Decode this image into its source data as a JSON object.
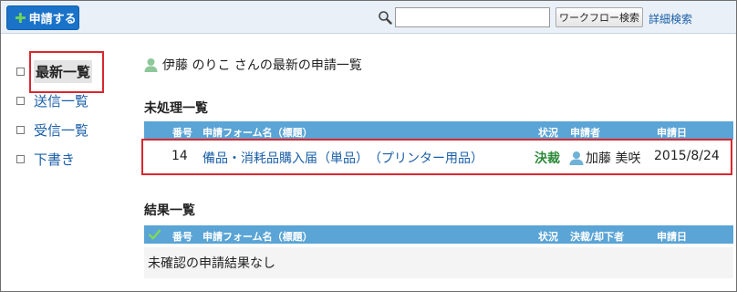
{
  "toolbar": {
    "apply_label": "申請する",
    "search_placeholder": "",
    "workflow_search_label": "ワークフロー検索",
    "advanced_search_label": "詳細検索"
  },
  "sidebar": {
    "items": [
      {
        "label": "最新一覧",
        "active": true
      },
      {
        "label": "送信一覧"
      },
      {
        "label": "受信一覧"
      },
      {
        "label": "下書き"
      }
    ]
  },
  "main": {
    "user_heading": "伊藤 のりこ さんの最新の申請一覧",
    "pending": {
      "title": "未処理一覧",
      "columns": {
        "number": "番号",
        "form_name": "申請フォーム名（標題）",
        "status": "状況",
        "applicant": "申請者",
        "date": "申請日"
      },
      "rows": [
        {
          "number": "14",
          "form_name": "備品・消耗品購入届（単品）　（プリンター用品）",
          "status": "決裁",
          "applicant": "加藤 美咲",
          "date": "2015/8/24"
        }
      ]
    },
    "results": {
      "title": "結果一覧",
      "columns": {
        "number": "番号",
        "form_name": "申請フォーム名（標題）",
        "status": "状況",
        "approver": "決裁/却下者",
        "date": "申請日"
      },
      "empty_message": "未確認の申請結果なし"
    }
  },
  "colors": {
    "accent": "#1a73c9",
    "header": "#5aa4d6",
    "approved": "#2e8b3a",
    "highlight": "#d9272e"
  }
}
